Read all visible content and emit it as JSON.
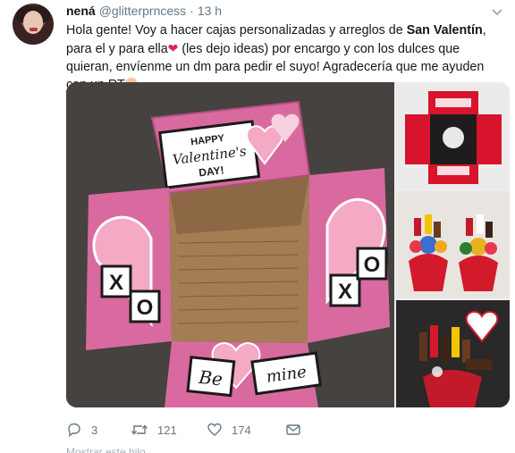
{
  "tweet": {
    "name": "nená",
    "handle": "@glitterprncess",
    "separator": "·",
    "time": "13 h",
    "text": {
      "part1": "Hola gente! Voy a hacer cajas personalizadas y arreglos de ",
      "bold": "San Valentín",
      "part2": ", para el y para ella",
      "part3": " (les dejo ideas) por encargo y con los dulces que quieran, envíenme un dm para pedir el suyo! Agradecería que me ayuden con un RT"
    },
    "heart_emoji": "❤",
    "box_text": {
      "happy": "HAPPY",
      "valentines": "Valentine's",
      "day": "DAY!",
      "x": "X",
      "o": "O",
      "be": "Be",
      "mine": "mine"
    },
    "actions": {
      "reply_count": "3",
      "retweet_count": "121",
      "like_count": "174"
    },
    "more_text": "Mostrar este hilo"
  },
  "colors": {
    "text": "#14171a",
    "muted": "#657786",
    "heart": "#e0245e",
    "box_pink": "#d96aa0",
    "light_pink": "#f4a9c4"
  }
}
